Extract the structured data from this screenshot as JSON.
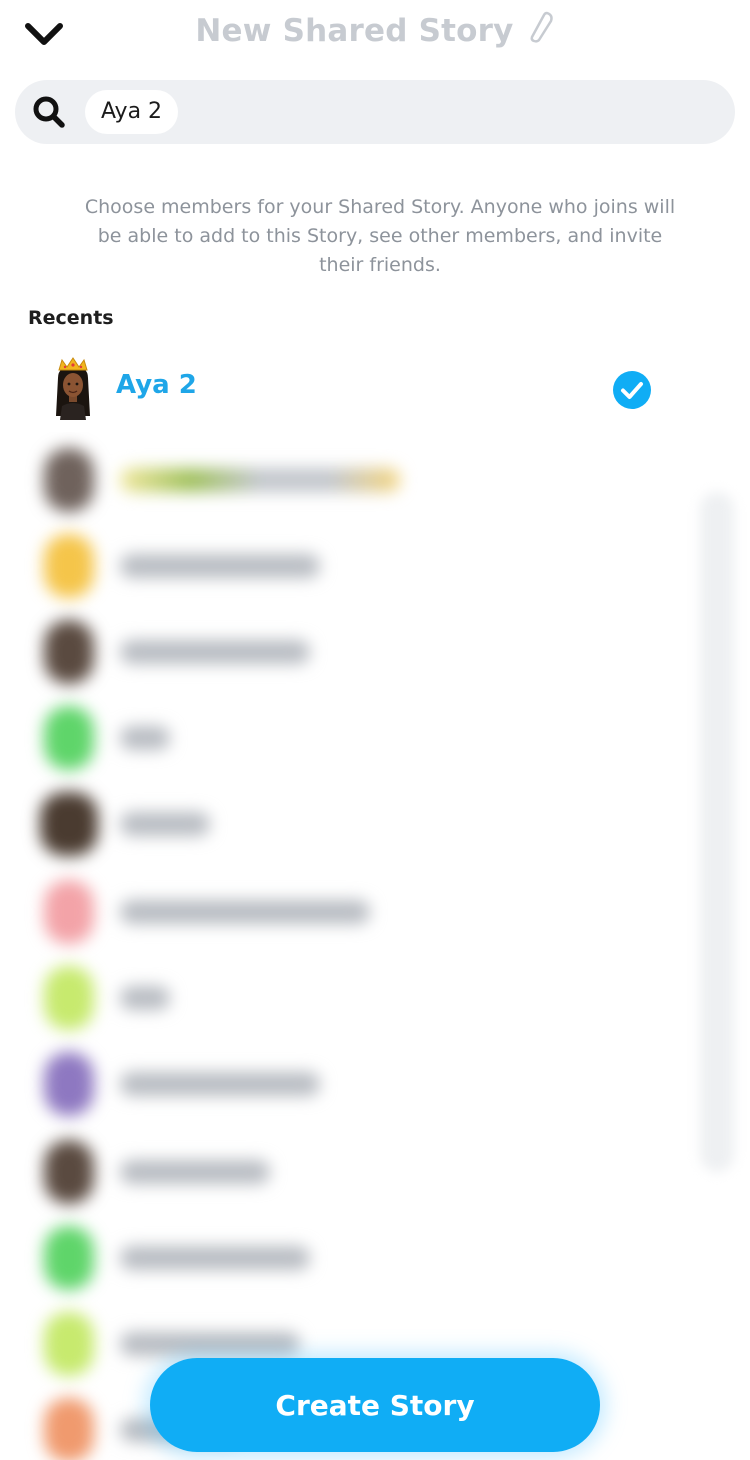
{
  "header": {
    "title": "New Shared Story",
    "back_icon": "chevron-down-icon",
    "edit_icon": "pencil-icon"
  },
  "search": {
    "icon": "search-icon",
    "chip_label": "Aya 2"
  },
  "instructions": "Choose members for your Shared Story. Anyone who joins will be able to add to this Story, see other members, and invite their friends.",
  "recents": {
    "heading": "Recents",
    "selected": {
      "name": "Aya 2",
      "selected": true,
      "check_icon": "check-circle-icon"
    }
  },
  "colors": {
    "accent": "#10adf5",
    "selected_name": "#1fa6e8",
    "title_gray": "#c7cbd1"
  },
  "create_button": {
    "label": "Create Story"
  }
}
